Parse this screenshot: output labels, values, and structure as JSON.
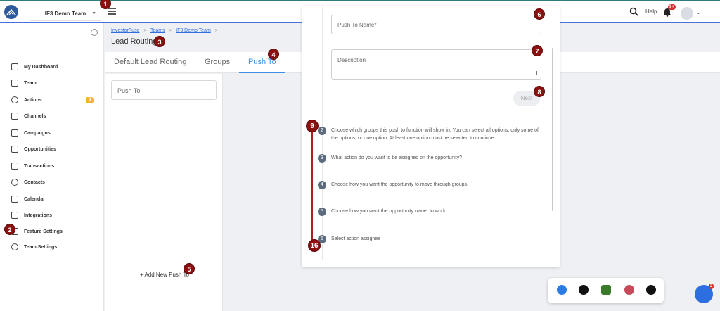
{
  "header": {
    "team_name": "IF3 Demo Team",
    "help_label": "Help",
    "notifications_badge": "9+"
  },
  "sidebar": {
    "items": [
      {
        "label": "My Dashboard",
        "icon": "grid-icon"
      },
      {
        "label": "Team",
        "icon": "layers-icon"
      },
      {
        "label": "Actions",
        "icon": "check-circle-icon",
        "badge": "3"
      },
      {
        "label": "Channels",
        "icon": "puzzle-icon"
      },
      {
        "label": "Campaigns",
        "icon": "megaphone-icon"
      },
      {
        "label": "Opportunities",
        "icon": "home-icon"
      },
      {
        "label": "Transactions",
        "icon": "money-icon"
      },
      {
        "label": "Contacts",
        "icon": "users-icon"
      },
      {
        "label": "Calendar",
        "icon": "calendar-icon"
      },
      {
        "label": "Integrations",
        "icon": "integrations-icon"
      },
      {
        "label": "Feature Settings",
        "icon": "sliders-icon"
      },
      {
        "label": "Team Settings",
        "icon": "gear-icon"
      }
    ]
  },
  "breadcrumb": [
    "InvestorFuse",
    "Teams",
    "IF3 Demo Team"
  ],
  "page_title": "Lead Routing",
  "tabs": [
    {
      "label": "Default Lead Routing",
      "active": false
    },
    {
      "label": "Groups",
      "active": false
    },
    {
      "label": "Push To",
      "active": true
    }
  ],
  "left_panel": {
    "push_to_label": "Push To",
    "add_new_label": "+ Add New Push To"
  },
  "modal": {
    "name_placeholder": "Push To Name*",
    "description_placeholder": "Description",
    "next_label": "Next",
    "steps": [
      {
        "num": "2",
        "text": "Choose which groups this push to function will show in. You can select all options, only some of the options, or one option. At least one option must be selected to continue."
      },
      {
        "num": "3",
        "text": "What action do you want to be assigned on the opportunity?"
      },
      {
        "num": "4",
        "text": "Choose how you want the opportunity to move through groups."
      },
      {
        "num": "5",
        "text": "Choose how you want the opportunity owner to work."
      },
      {
        "num": "6",
        "text": "Select action assignee"
      }
    ]
  },
  "markers": [
    "1",
    "2",
    "3",
    "4",
    "5",
    "6",
    "7",
    "8",
    "9",
    "16"
  ],
  "chat_badge": "2",
  "colors": {
    "accent": "#3b8fe4",
    "marker": "#8b1010",
    "badge": "#f2b52b"
  }
}
